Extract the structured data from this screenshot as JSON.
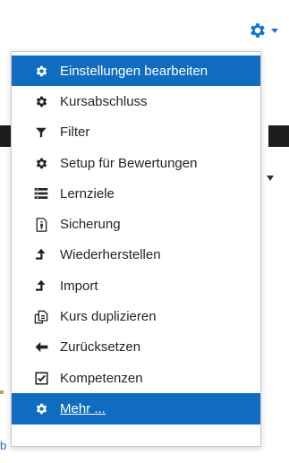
{
  "trigger": {
    "icon": "gear-icon",
    "accent": "#1177d1"
  },
  "menu": {
    "items": [
      {
        "label": "Einstellungen bearbeiten",
        "icon": "gear-icon",
        "active": true
      },
      {
        "label": "Kursabschluss",
        "icon": "gear-icon",
        "active": false
      },
      {
        "label": "Filter",
        "icon": "filter-icon",
        "active": false
      },
      {
        "label": "Setup für Bewertungen",
        "icon": "gear-icon",
        "active": false
      },
      {
        "label": "Lernziele",
        "icon": "list-icon",
        "active": false
      },
      {
        "label": "Sicherung",
        "icon": "backup-file-icon",
        "active": false
      },
      {
        "label": "Wiederherstellen",
        "icon": "upload-arrow-icon",
        "active": false
      },
      {
        "label": "Import",
        "icon": "upload-arrow-icon",
        "active": false
      },
      {
        "label": "Kurs duplizieren",
        "icon": "copy-icon",
        "active": false
      },
      {
        "label": "Zurücksetzen",
        "icon": "arrow-left-icon",
        "active": false
      },
      {
        "label": "Kompetenzen",
        "icon": "checkbox-icon",
        "active": false
      },
      {
        "label": "Mehr ...",
        "icon": "gear-icon",
        "active": true
      }
    ],
    "highlight_color": "#0f6cbf"
  },
  "background": {
    "fragment_text": "b"
  }
}
